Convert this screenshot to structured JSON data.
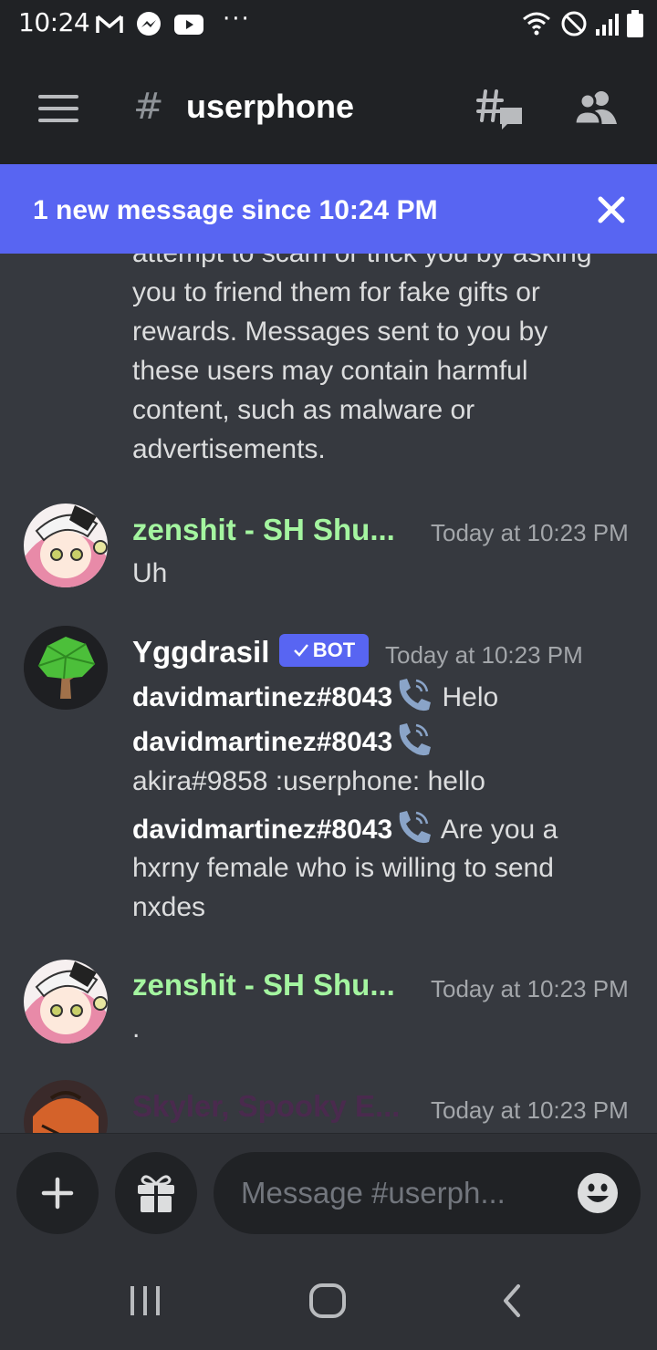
{
  "status_bar": {
    "time": "10:24",
    "overflow": "···"
  },
  "header": {
    "hash": "#",
    "channel": "userphone"
  },
  "banner": {
    "text": "1 new message since 10:24 PM"
  },
  "messages": {
    "partial_text": [
      "attempt to scam or trick you by asking",
      "you to friend them for fake gifts or",
      "rewards. Messages sent to you by",
      "these users may contain harmful",
      "content, such as malware or",
      "advertisements."
    ],
    "msg1": {
      "author": "zenshit - SH Shu...",
      "author_color": "#a4f5a0",
      "time": "Today at 10:23 PM",
      "text": "Uh"
    },
    "msg2": {
      "author": "Yggdrasil",
      "bot_label": "BOT",
      "time": "Today at 10:23 PM",
      "lines": [
        {
          "user": "davidmartinez#8043",
          "text": "Helo"
        },
        {
          "user": "davidmartinez#8043",
          "text": ""
        },
        {
          "user": "",
          "text": "akira#9858 :userphone: hello"
        },
        {
          "user": "davidmartinez#8043",
          "text": "Are you a"
        },
        {
          "user": "",
          "text": "hxrny female who is willing to send"
        },
        {
          "user": "",
          "text": "nxdes"
        }
      ]
    },
    "msg3": {
      "author": "zenshit - SH Shu...",
      "time": "Today at 10:23 PM",
      "text": "."
    },
    "msg4": {
      "author": "Skyler, Spooky E...",
      "author_color": "#4a2a4e",
      "time": "Today at 10:23 PM"
    }
  },
  "composer": {
    "placeholder": "Message #userph..."
  },
  "icons": [
    "gmail-icon",
    "messenger-icon",
    "youtube-icon",
    "wifi-icon",
    "do-not-disturb-icon",
    "signal-icon",
    "battery-icon",
    "menu-icon",
    "threads-icon",
    "members-icon",
    "close-icon",
    "phone-icon",
    "plus-icon",
    "gift-icon",
    "emoji-icon",
    "recent-apps-icon",
    "home-icon",
    "back-icon"
  ]
}
